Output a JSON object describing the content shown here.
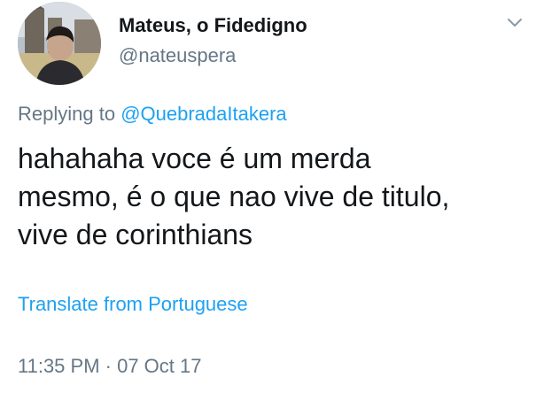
{
  "author": {
    "display_name": "Mateus, o Fidedigno",
    "handle": "@nateuspera",
    "avatar_icon": "profile-photo"
  },
  "menu": {
    "icon": "chevron-down-icon"
  },
  "reply": {
    "prefix": "Replying to",
    "mention": "@QuebradaItakera"
  },
  "tweet": {
    "text": "hahahaha voce é um merda\nmesmo, é o que nao vive de titulo,\nvive de corinthians"
  },
  "translate": {
    "label": "Translate from Portuguese"
  },
  "meta": {
    "timestamp": "11:35 PM · 07 Oct 17"
  },
  "colors": {
    "link": "#1da1f2",
    "secondary_text": "#657786",
    "primary_text": "#14171a"
  }
}
